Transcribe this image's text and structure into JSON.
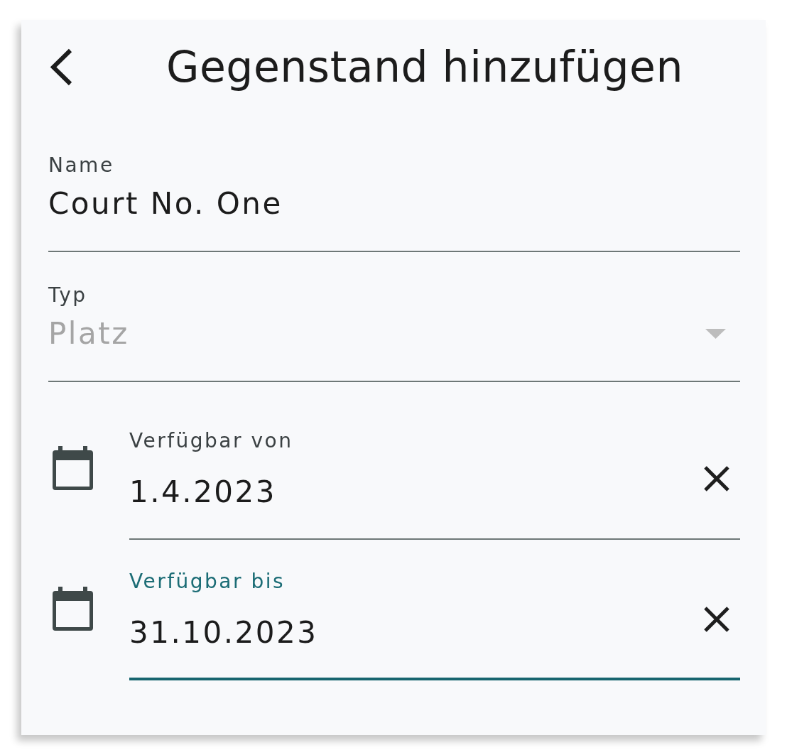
{
  "header": {
    "title": "Gegenstand hinzufügen"
  },
  "fields": [
    {
      "kind": "text",
      "label": "Name",
      "value": "Court No. One",
      "focused": false,
      "disabled": false
    },
    {
      "kind": "select",
      "label": "Typ",
      "value": "Platz",
      "focused": false,
      "disabled": true
    },
    {
      "kind": "date",
      "label": "Verfügbar von",
      "value": "1.4.2023",
      "focused": false,
      "disabled": false
    },
    {
      "kind": "date",
      "label": "Verfügbar bis",
      "value": "31.10.2023",
      "focused": true,
      "disabled": false
    }
  ]
}
